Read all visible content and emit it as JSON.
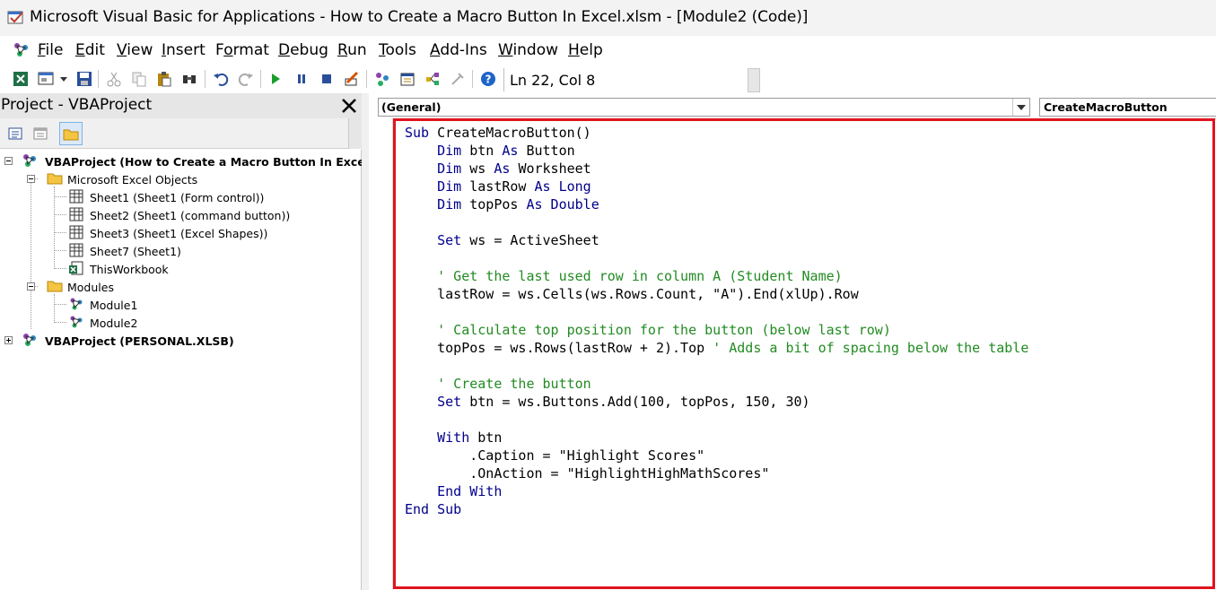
{
  "window": {
    "title": "Microsoft Visual Basic for Applications - How to Create a Macro Button In Excel.xlsm - [Module2 (Code)]"
  },
  "menu": {
    "items": [
      {
        "underline": "F",
        "rest": "ile"
      },
      {
        "underline": "E",
        "rest": "dit"
      },
      {
        "underline": "V",
        "rest": "iew"
      },
      {
        "underline": "I",
        "rest": "nsert"
      },
      {
        "pre": "F",
        "underline": "o",
        "rest": "rmat"
      },
      {
        "underline": "D",
        "rest": "ebug"
      },
      {
        "underline": "R",
        "rest": "un"
      },
      {
        "underline": "T",
        "rest": "ools"
      },
      {
        "underline": "A",
        "rest": "dd-Ins"
      },
      {
        "underline": "W",
        "rest": "indow"
      },
      {
        "underline": "H",
        "rest": "elp"
      }
    ]
  },
  "toolbar": {
    "status": "Ln 22, Col 8",
    "colors": {
      "run": "#1a9e2a",
      "help": "#1e64c8"
    }
  },
  "project_panel": {
    "title": "Project - VBAProject",
    "tree": [
      {
        "label": "VBAProject (How to Create a Macro Button In Excel.xl.",
        "bold": true
      },
      {
        "label": "Microsoft Excel Objects",
        "bold": false
      },
      {
        "label": "Sheet1 (Sheet1 (Form control))",
        "bold": false
      },
      {
        "label": "Sheet2 (Sheet1 (command button))",
        "bold": false
      },
      {
        "label": "Sheet3 (Sheet1 (Excel Shapes))",
        "bold": false
      },
      {
        "label": "Sheet7 (Sheet1)",
        "bold": false
      },
      {
        "label": "ThisWorkbook",
        "bold": false
      },
      {
        "label": "Modules",
        "bold": false
      },
      {
        "label": "Module1",
        "bold": false
      },
      {
        "label": "Module2",
        "bold": false
      },
      {
        "label": "VBAProject (PERSONAL.XLSB)",
        "bold": true
      }
    ]
  },
  "editor": {
    "object_combo": "(General)",
    "procedure_combo": "CreateMacroButton",
    "highlight_color": "#e0141e",
    "lines": [
      [
        [
          "kw",
          "Sub "
        ],
        [
          "tx",
          "CreateMacroButton()"
        ]
      ],
      [
        [
          "kw",
          "    Dim "
        ],
        [
          "tx",
          "btn "
        ],
        [
          "kw",
          "As "
        ],
        [
          "tx",
          "Button"
        ]
      ],
      [
        [
          "kw",
          "    Dim "
        ],
        [
          "tx",
          "ws "
        ],
        [
          "kw",
          "As "
        ],
        [
          "tx",
          "Worksheet"
        ]
      ],
      [
        [
          "kw",
          "    Dim "
        ],
        [
          "tx",
          "lastRow "
        ],
        [
          "kw",
          "As Long"
        ]
      ],
      [
        [
          "kw",
          "    Dim "
        ],
        [
          "tx",
          "topPos "
        ],
        [
          "kw",
          "As Double"
        ]
      ],
      [
        [
          "tx",
          ""
        ]
      ],
      [
        [
          "kw",
          "    Set "
        ],
        [
          "tx",
          "ws = ActiveSheet"
        ]
      ],
      [
        [
          "tx",
          ""
        ]
      ],
      [
        [
          "cm",
          "    ' Get the last used row in column A (Student Name)"
        ]
      ],
      [
        [
          "tx",
          "    lastRow = ws.Cells(ws.Rows.Count, \"A\").End(xlUp).Row"
        ]
      ],
      [
        [
          "tx",
          ""
        ]
      ],
      [
        [
          "cm",
          "    ' Calculate top position for the button (below last row)"
        ]
      ],
      [
        [
          "tx",
          "    topPos = ws.Rows(lastRow + 2).Top "
        ],
        [
          "cm",
          "' Adds a bit of spacing below the table"
        ]
      ],
      [
        [
          "tx",
          ""
        ]
      ],
      [
        [
          "cm",
          "    ' Create the button"
        ]
      ],
      [
        [
          "kw",
          "    Set "
        ],
        [
          "tx",
          "btn = ws.Buttons.Add(100, topPos, 150, 30)"
        ]
      ],
      [
        [
          "tx",
          ""
        ]
      ],
      [
        [
          "kw",
          "    With "
        ],
        [
          "tx",
          "btn"
        ]
      ],
      [
        [
          "tx",
          "        .Caption = \"Highlight Scores\""
        ]
      ],
      [
        [
          "tx",
          "        .OnAction = \"HighlightHighMathScores\""
        ]
      ],
      [
        [
          "kw",
          "    End With"
        ]
      ],
      [
        [
          "kw",
          "End Sub"
        ]
      ]
    ]
  }
}
